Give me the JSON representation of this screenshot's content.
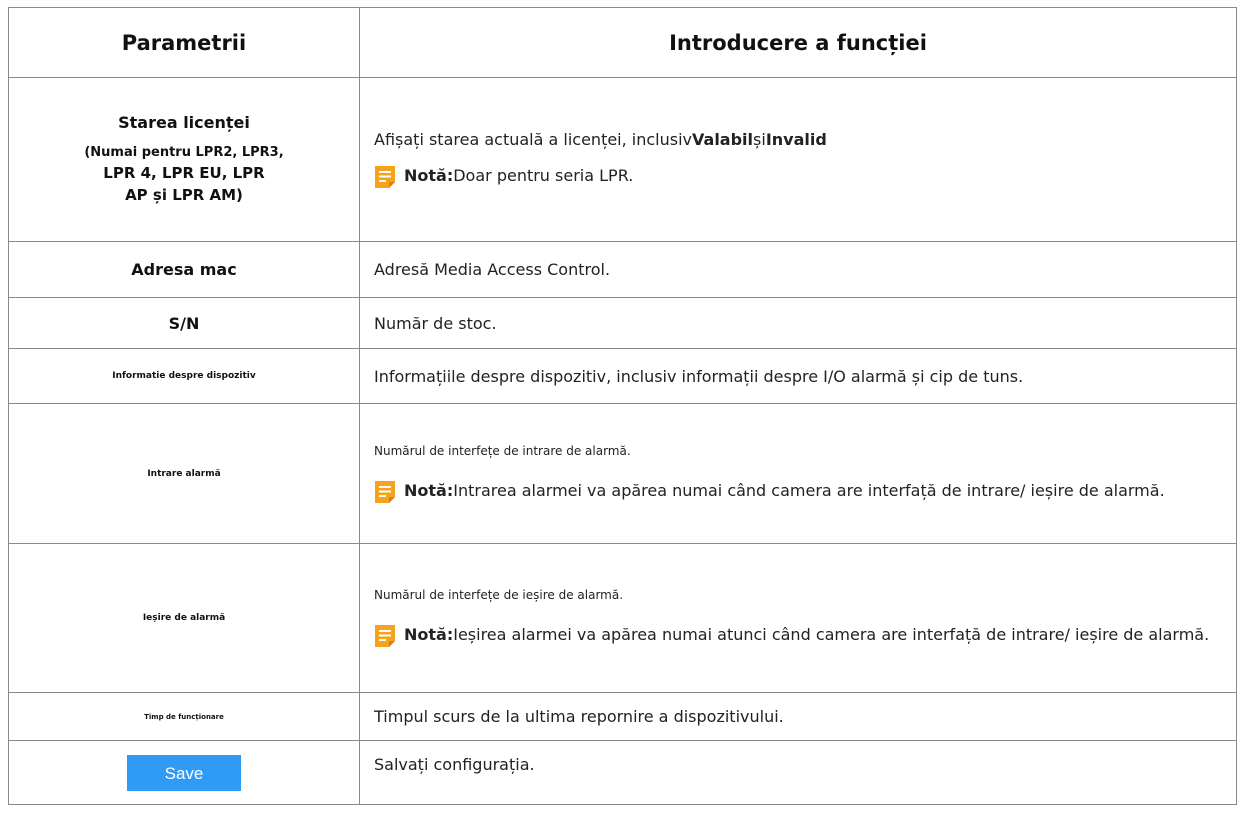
{
  "header": {
    "col_params": "Parametrii",
    "col_intro": "Introducere a funcției"
  },
  "rows": {
    "license": {
      "title": "Starea licenței",
      "sub1": "(Numai pentru LPR2, LPR3,",
      "sub2": "LPR 4, LPR EU, LPR",
      "sub3": "AP și LPR AM)",
      "desc_prefix": "Afișați starea actuală a licenței, inclusiv",
      "desc_valid": "Valabil",
      "desc_mid": "și",
      "desc_invalid": "Invalid",
      "note_label": "Notă:",
      "note_text": "Doar pentru seria LPR."
    },
    "mac": {
      "label": "Adresa mac",
      "desc": "Adresă Media Access Control."
    },
    "sn": {
      "label": "S/N",
      "desc": "Număr de stoc."
    },
    "device_info": {
      "label": "Informatie despre dispozitiv",
      "desc": "Informațiile despre dispozitiv, inclusiv informații despre I/O alarmă și cip de tuns."
    },
    "alarm_in": {
      "label": "Intrare alarmă",
      "desc": "Numărul de interfețe de intrare de alarmă.",
      "note_label": "Notă:",
      "note_text": "Intrarea alarmei va apărea numai când camera are interfață de intrare/ ieșire de alarmă."
    },
    "alarm_out": {
      "label": "Ieșire de alarmă",
      "desc": "Numărul de interfețe de ieșire de alarmă.",
      "note_label": "Notă:",
      "note_text": "Ieșirea alarmei va apărea numai atunci când camera are interfață de intrare/ ieșire de alarmă."
    },
    "uptime": {
      "label": "Timp de funcționare",
      "desc": "Timpul scurs de la ultima repornire a dispozitivului."
    },
    "save": {
      "button_label": "Save",
      "desc": "Salvați configurația."
    }
  },
  "colors": {
    "save_button": "#2f9bf5",
    "note_icon": "#f7a21b",
    "border": "#8a8a8a"
  },
  "icons": {
    "note": "note-icon"
  }
}
